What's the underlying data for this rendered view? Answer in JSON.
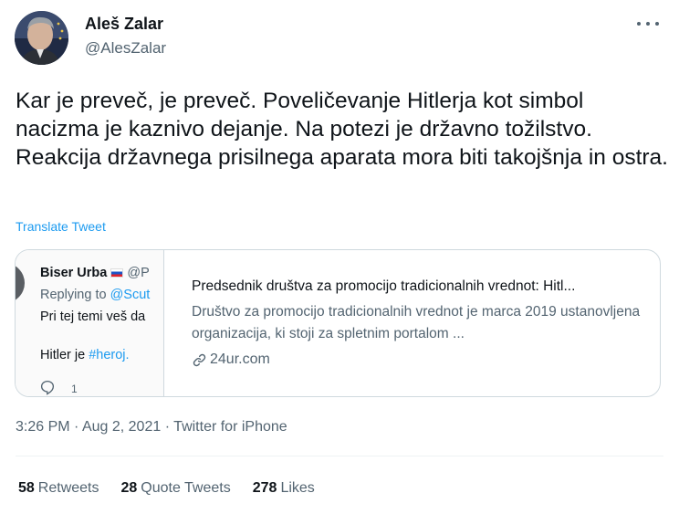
{
  "author": {
    "name": "Aleš Zalar",
    "handle": "@AlesZalar"
  },
  "tweet": {
    "text": "Kar je preveč, je preveč. Poveličevanje Hitlerja kot simbol nacizma je kaznivo dejanje. Na potezi je državno tožilstvo. Reakcija državnega prisilnega aparata mora biti takojšnja in ostra.",
    "translate_label": "Translate Tweet"
  },
  "quoted_tweet": {
    "author_name": "Biser Urba",
    "author_handle_partial": "@P",
    "replying_prefix": "Replying to",
    "replying_handle_partial": "@Scut",
    "text_line1_partial": "Pri tej temi veš da",
    "text_line2_prefix": "Hitler je",
    "text_line2_hashtag": "#heroj.",
    "reply_count": "1"
  },
  "link_card": {
    "title": "Predsednik društva za promocijo tradicionalnih vrednot: Hitl...",
    "description": "Društvo za promocijo tradicionalnih vrednot je marca 2019 ustanovljena organizacija, ki stoji za spletnim portalom ...",
    "domain": "24ur.com"
  },
  "meta": {
    "time": "3:26 PM",
    "separator": "·",
    "date": "Aug 2, 2021",
    "source": "Twitter for iPhone"
  },
  "stats": {
    "retweets_count": "58",
    "retweets_label": "Retweets",
    "quotes_count": "28",
    "quotes_label": "Quote Tweets",
    "likes_count": "278",
    "likes_label": "Likes"
  },
  "icons": {
    "more": "more-dots-icon",
    "reply": "reply-icon",
    "link": "link-icon",
    "flag": "slovenia-flag-icon"
  },
  "colors": {
    "link_blue": "#1d9bf0",
    "secondary_text": "#536471",
    "border": "#cfd9de"
  }
}
